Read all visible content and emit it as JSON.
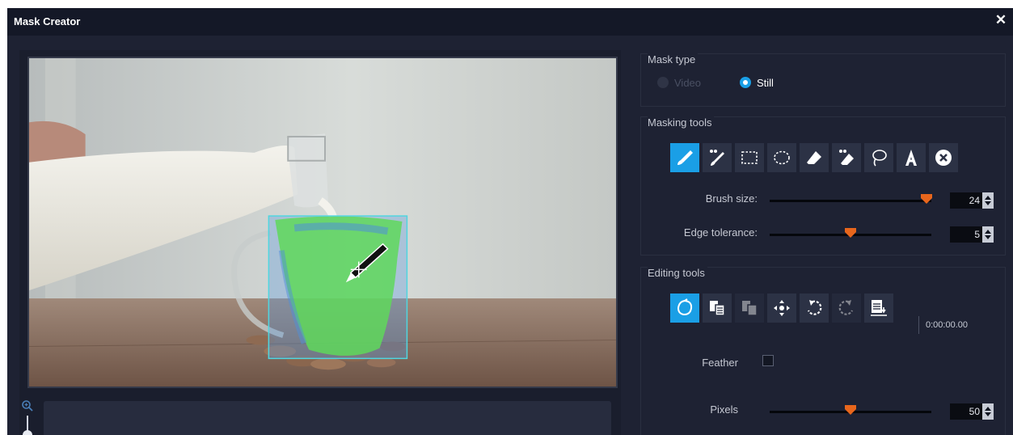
{
  "window": {
    "title": "Mask Creator",
    "close_glyph": "✕"
  },
  "mask_type": {
    "label": "Mask type",
    "options": [
      {
        "label": "Video",
        "selected": false,
        "enabled": false
      },
      {
        "label": "Still",
        "selected": true,
        "enabled": true
      }
    ]
  },
  "masking_tools": {
    "label": "Masking tools",
    "tools": [
      {
        "icon": "brush-icon",
        "active": true
      },
      {
        "icon": "smart-brush-icon",
        "active": false
      },
      {
        "icon": "rectangle-select-icon",
        "active": false
      },
      {
        "icon": "ellipse-select-icon",
        "active": false
      },
      {
        "icon": "eraser-icon",
        "active": false
      },
      {
        "icon": "smart-eraser-icon",
        "active": false
      },
      {
        "icon": "lasso-icon",
        "active": false
      },
      {
        "icon": "text-icon",
        "active": false
      },
      {
        "icon": "clear-mask-icon",
        "active": false
      }
    ],
    "brush_size": {
      "label": "Brush size:",
      "value": 24,
      "level": 0.97
    },
    "edge_tolerance": {
      "label": "Edge tolerance:",
      "value": 5,
      "level": 0.5
    }
  },
  "editing_tools": {
    "label": "Editing tools",
    "tools": [
      {
        "icon": "auto-mask-icon",
        "active": true,
        "enabled": true
      },
      {
        "icon": "copy-mask-icon",
        "active": false,
        "enabled": true
      },
      {
        "icon": "paste-mask-icon",
        "active": false,
        "enabled": false
      },
      {
        "icon": "move-icon",
        "active": false,
        "enabled": true
      },
      {
        "icon": "undo-icon",
        "active": false,
        "enabled": true
      },
      {
        "icon": "redo-icon",
        "active": false,
        "enabled": false
      },
      {
        "icon": "apply-mask-icon",
        "active": false,
        "enabled": true
      }
    ],
    "timecode": "0:00:00.00",
    "feather": {
      "label": "Feather",
      "checked": false
    },
    "pixels": {
      "label": "Pixels",
      "value": 50,
      "level": 0.5
    }
  },
  "colors": {
    "accent": "#1a9fe6",
    "slider_thumb": "#e8661c",
    "mask_fill": "#5fd85a"
  }
}
